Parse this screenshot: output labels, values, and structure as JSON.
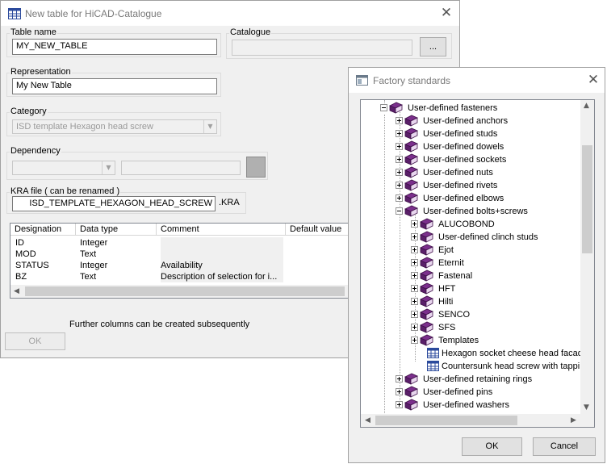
{
  "main_window": {
    "title": "New table for HiCAD-Catalogue",
    "table_name_label": "Table name",
    "table_name_value": "MY_NEW_TABLE",
    "catalogue_label": "Catalogue",
    "catalogue_value": "",
    "browse_label": "...",
    "representation_label": "Representation",
    "representation_value": "My New Table",
    "category_label": "Category",
    "category_value": "ISD template Hexagon head screw",
    "dependency_label": "Dependency",
    "kra_label": "KRA file ( can be renamed )",
    "kra_value": "ISD_TEMPLATE_HEXAGON_HEAD_SCREW",
    "kra_ext": ".KRA",
    "columns": [
      "Designation",
      "Data type",
      "Comment",
      "Default value"
    ],
    "rows": [
      [
        "ID",
        "Integer",
        "",
        ""
      ],
      [
        "MOD",
        "Text",
        "",
        ""
      ],
      [
        "STATUS",
        "Integer",
        "Availability",
        ""
      ],
      [
        "BZ",
        "Text",
        "Description of selection for i...",
        ""
      ]
    ],
    "note": "Further columns can be created subsequently",
    "ok_label": "OK"
  },
  "factory_window": {
    "title": "Factory standards",
    "tree": [
      {
        "label": "User-defined fasteners",
        "icon": "book-icon"
      },
      {
        "label": "User-defined anchors",
        "icon": "book-icon"
      },
      {
        "label": "User-defined studs",
        "icon": "book-icon"
      },
      {
        "label": "User-defined dowels",
        "icon": "book-icon"
      },
      {
        "label": "User-defined sockets",
        "icon": "book-icon"
      },
      {
        "label": "User-defined nuts",
        "icon": "book-icon"
      },
      {
        "label": "User-defined rivets",
        "icon": "book-icon"
      },
      {
        "label": "User-defined elbows",
        "icon": "book-icon"
      },
      {
        "label": "User-defined bolts+screws",
        "icon": "book-icon"
      },
      {
        "label": "ALUCOBOND",
        "icon": "book-icon"
      },
      {
        "label": "User-defined clinch studs",
        "icon": "book-icon"
      },
      {
        "label": "Ejot",
        "icon": "book-icon"
      },
      {
        "label": "Eternit",
        "icon": "book-icon"
      },
      {
        "label": "Fastenal",
        "icon": "book-icon"
      },
      {
        "label": "HFT",
        "icon": "book-icon"
      },
      {
        "label": "Hilti",
        "icon": "book-icon"
      },
      {
        "label": "SENCO",
        "icon": "book-icon"
      },
      {
        "label": "SFS",
        "icon": "book-icon"
      },
      {
        "label": "Templates",
        "icon": "book-icon"
      },
      {
        "label": "Hexagon socket cheese head facade",
        "icon": "table-icon"
      },
      {
        "label": "Countersunk head screw with tappin",
        "icon": "table-icon"
      },
      {
        "label": "User-defined retaining rings",
        "icon": "book-icon"
      },
      {
        "label": "User-defined pins",
        "icon": "book-icon"
      },
      {
        "label": "User-defined washers",
        "icon": "book-icon"
      }
    ],
    "ok_label": "OK",
    "cancel_label": "Cancel"
  },
  "colors": {
    "book": "#7b2f8c",
    "selection_blue": "#0078d7"
  }
}
